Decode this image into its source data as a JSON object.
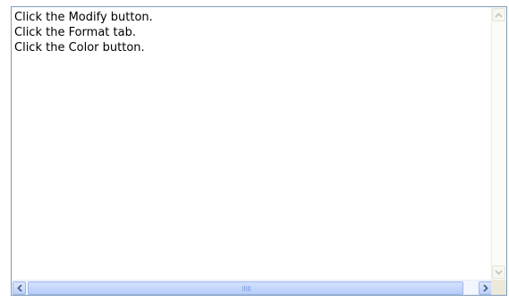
{
  "text_area": {
    "lines": [
      "Click the Modify button.",
      "Click the Format tab.",
      "Click the Color button."
    ]
  },
  "colors": {
    "border": "#7f9db9",
    "scrollbar_track": "#f3f6fd",
    "scrollbar_thumb": "#c4d6fa"
  },
  "icons": {
    "scroll_up": "chevron-up-icon",
    "scroll_down": "chevron-down-icon",
    "scroll_left": "chevron-left-icon",
    "scroll_right": "chevron-right-icon"
  }
}
